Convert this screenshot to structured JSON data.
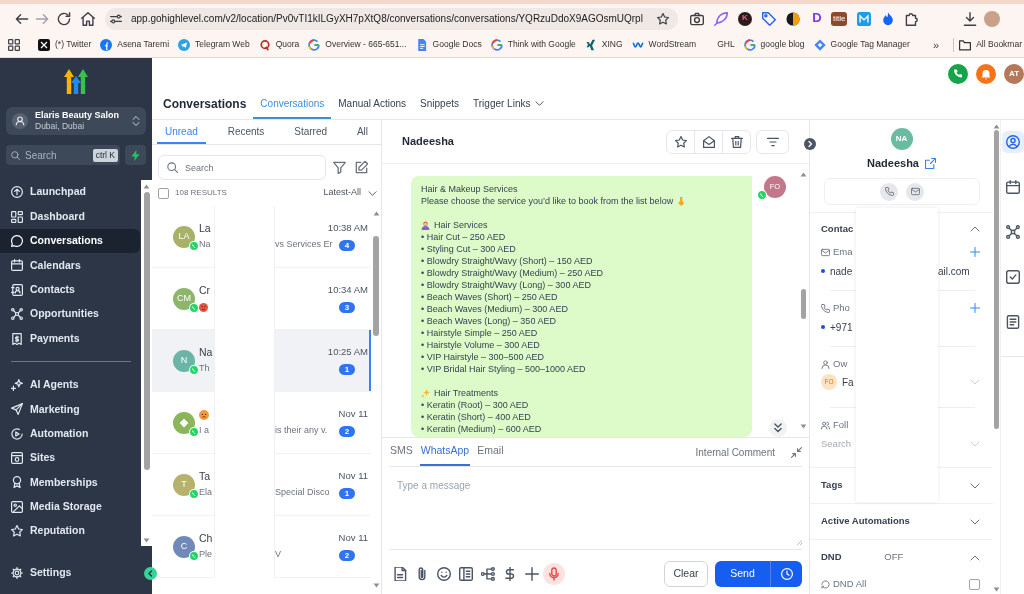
{
  "browser": {
    "url": "app.gohighlevel.com/v2/location/Pv0vTI1kILGyXH7pXtQ8/conversations/conversations/YQRzuDdoX9AGOsmUQrpl",
    "extensions": [
      {
        "kind": "icon"
      },
      {
        "kind": "icon"
      },
      {
        "kind": "letter",
        "text": "K"
      },
      {
        "kind": "icon"
      },
      {
        "kind": "icon"
      },
      {
        "kind": "letter",
        "text": "D"
      },
      {
        "kind": "label",
        "text": "title"
      },
      {
        "kind": "icon"
      },
      {
        "kind": "icon"
      },
      {
        "kind": "icon"
      }
    ],
    "bookmarks": [
      {
        "label": "(*) Twitter"
      },
      {
        "label": "Asena Taremi"
      },
      {
        "label": "Telegram Web"
      },
      {
        "label": "Quora"
      },
      {
        "label": "Overview - 665-651..."
      },
      {
        "label": "Google Docs"
      },
      {
        "label": "Think with Google"
      },
      {
        "label": "XING"
      },
      {
        "label": "WordStream"
      },
      {
        "label": "GHL"
      },
      {
        "label": "google blog"
      },
      {
        "label": "Google Tag Manager"
      }
    ],
    "more": "»",
    "all_bookmarks": "All Bookmar"
  },
  "sidebar": {
    "location": {
      "name": "Elaris Beauty Salon",
      "address": "Dubai, Dubai"
    },
    "search": {
      "placeholder": "Search",
      "shortcut": "ctrl K"
    },
    "nav_groups": [
      {
        "items": [
          {
            "label": "Launchpad",
            "selected": false
          },
          {
            "label": "Dashboard",
            "selected": false
          },
          {
            "label": "Conversations",
            "selected": true
          },
          {
            "label": "Calendars",
            "selected": false
          },
          {
            "label": "Contacts",
            "selected": false
          },
          {
            "label": "Opportunities",
            "selected": false
          },
          {
            "label": "Payments",
            "selected": false
          }
        ]
      },
      {
        "items": [
          {
            "label": "AI Agents",
            "selected": false
          },
          {
            "label": "Marketing",
            "selected": false
          },
          {
            "label": "Automation",
            "selected": false
          },
          {
            "label": "Sites",
            "selected": false
          },
          {
            "label": "Memberships",
            "selected": false
          },
          {
            "label": "Media Storage",
            "selected": false
          },
          {
            "label": "Reputation",
            "selected": false
          }
        ]
      }
    ],
    "settings": {
      "label": "Settings",
      "selected": false
    }
  },
  "header": {
    "title": "Conversations",
    "tabs": [
      {
        "label": "Conversations",
        "selected": true
      },
      {
        "label": "Manual Actions",
        "selected": false
      },
      {
        "label": "Snippets",
        "selected": false
      },
      {
        "label": "Trigger Links",
        "selected": false,
        "dropdown": true
      }
    ],
    "user_initials": "AT"
  },
  "conversations": {
    "tabs": [
      {
        "label": "Unread",
        "selected": true
      },
      {
        "label": "Recents",
        "selected": false
      },
      {
        "label": "Starred",
        "selected": false
      },
      {
        "label": "All",
        "selected": false
      }
    ],
    "search": {
      "placeholder": "Search"
    },
    "select_all": {
      "checked": false
    },
    "results": "108 RESULTS",
    "sort": "Latest-All",
    "rows": [
      {
        "avatar": {
          "kind": "initials",
          "initials": "LA",
          "color": "#a7b268"
        },
        "name": "La",
        "preview": "Na",
        "preview_tail": "vs Services Er",
        "time": "10:38 AM",
        "unread": "4",
        "selected": false
      },
      {
        "avatar": {
          "kind": "initials",
          "initials": "CM",
          "color": "#8db56c"
        },
        "name": "Cr",
        "preview_emoji": true,
        "time": "10:34 AM",
        "unread": "3",
        "selected": false
      },
      {
        "avatar": {
          "kind": "initials",
          "initials": "N",
          "color": "#6bb5a6"
        },
        "name": "Na",
        "preview": "Th",
        "time": "10:25 AM",
        "unread": "1",
        "selected": true
      },
      {
        "avatar": {
          "kind": "icon",
          "color": "#8db55a"
        },
        "name_emoji": true,
        "preview": "I a",
        "preview_tail": "is their any v.",
        "time": "Nov 11",
        "unread": "2",
        "selected": false
      },
      {
        "avatar": {
          "kind": "initials",
          "initials": "T",
          "color": "#b6b26c"
        },
        "name": "Ta",
        "preview": "Ela",
        "preview_tail": "Special Disco",
        "time": "Nov 11",
        "unread": "1",
        "selected": false
      },
      {
        "avatar": {
          "kind": "initials",
          "initials": "C",
          "color": "#7089b8"
        },
        "name": "Ch",
        "preview": "Ple",
        "preview_tail": "V",
        "time": "Nov 11",
        "unread": "2",
        "selected": false
      }
    ]
  },
  "chat": {
    "contact": "Nadeesha",
    "message": {
      "sender_initials": "FO",
      "lines": [
        {
          "kind": "text",
          "text": "Hair & Makeup Services"
        },
        {
          "kind": "intro",
          "text": "Please choose the service you’d like to book from the list below"
        },
        {
          "kind": "blank"
        },
        {
          "kind": "section",
          "text": "Hair Services"
        },
        {
          "kind": "text",
          "text": "• Hair Cut – 250 AED"
        },
        {
          "kind": "text",
          "text": "• Styling Cut – 300 AED"
        },
        {
          "kind": "text",
          "text": "• Blowdry Straight/Wavy (Short) – 150 AED"
        },
        {
          "kind": "text",
          "text": "• Blowdry Straight/Wavy (Medium) – 250 AED"
        },
        {
          "kind": "text",
          "text": "• Blowdry Straight/Wavy (Long) – 300 AED"
        },
        {
          "kind": "text",
          "text": "• Beach Waves (Short) – 250 AED"
        },
        {
          "kind": "text",
          "text": "• Beach Waves (Medium) – 300 AED"
        },
        {
          "kind": "text",
          "text": "• Beach Waves (Long) – 350 AED"
        },
        {
          "kind": "text",
          "text": "• Hairstyle Simple – 250 AED"
        },
        {
          "kind": "text",
          "text": "• Hairstyle Volume – 300 AED"
        },
        {
          "kind": "text",
          "text": "• VIP Hairstyle – 300–500 AED"
        },
        {
          "kind": "text",
          "text": "• VIP Bridal Hair Styling – 500–1000 AED"
        },
        {
          "kind": "blank"
        },
        {
          "kind": "section",
          "text": "Hair Treatments"
        },
        {
          "kind": "text",
          "text": "• Keratin (Root) – 300 AED"
        },
        {
          "kind": "text",
          "text": "• Keratin (Short) – 400 AED"
        },
        {
          "kind": "text",
          "text": "• Keratin (Medium) – 600 AED"
        }
      ]
    },
    "composer": {
      "channels": [
        {
          "label": "SMS",
          "selected": false
        },
        {
          "label": "WhatsApp",
          "selected": true
        },
        {
          "label": "Email",
          "selected": false
        }
      ],
      "internal_comment": "Internal Comment",
      "placeholder": "Type a message",
      "clear": "Clear",
      "send": "Send"
    }
  },
  "contact": {
    "initials": "NA",
    "name": "Nadeesha",
    "details": {
      "label": "Contac",
      "expanded": true,
      "email": {
        "label": "Ema",
        "value_start": "nade",
        "value_end": "ail.com"
      },
      "phone": {
        "label": "Pho",
        "value_start": "+971"
      },
      "owner": {
        "label": "Ow",
        "initials": "FO",
        "name": "Fa"
      },
      "followers": {
        "label": "Foll",
        "placeholder": "Search"
      }
    },
    "sections": [
      {
        "label": "Tags",
        "expanded": false
      },
      {
        "label": "Active Automations",
        "expanded": false
      },
      {
        "label": "DND",
        "expanded": true,
        "status": "OFF",
        "options": [
          {
            "label": "DND All",
            "checked": false
          }
        ]
      }
    ]
  },
  "rail": [
    {
      "selected": true
    },
    {
      "selected": false
    },
    {
      "selected": false
    },
    {
      "selected": false
    },
    {
      "selected": false
    }
  ]
}
